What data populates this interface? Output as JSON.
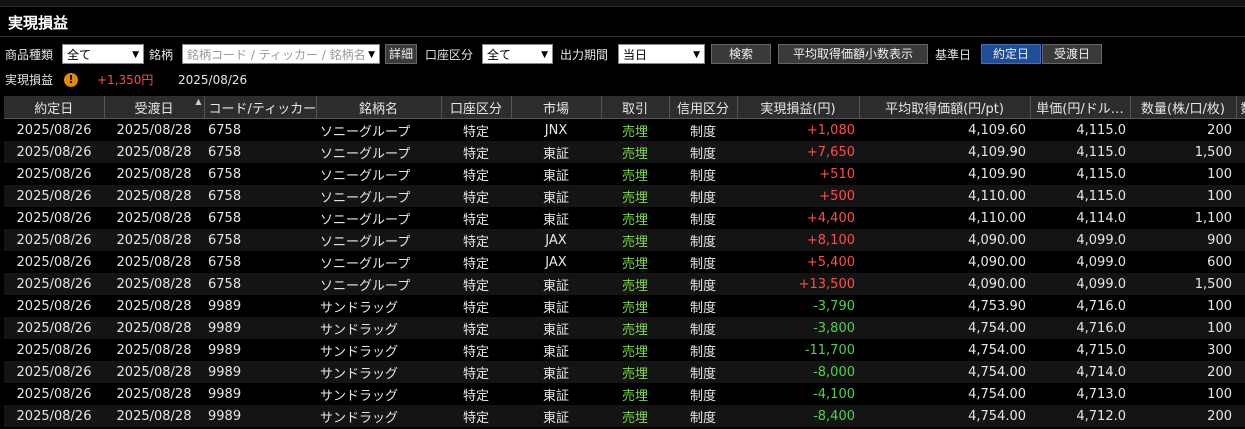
{
  "title": "実現損益",
  "toolbar": {
    "product_label": "商品種類",
    "product_value": "全て",
    "symbol_label": "銘柄",
    "symbol_placeholder": "銘柄コード / ティッカー / 銘柄名",
    "detail_button": "詳細",
    "account_label": "口座区分",
    "account_value": "全て",
    "period_label": "出力期間",
    "period_value": "当日",
    "search_button": "検索",
    "decimal_button": "平均取得価額小数表示",
    "base_date_label": "基準日",
    "contract_date_button": "約定日",
    "delivery_date_button": "受渡日"
  },
  "summary": {
    "label": "実現損益",
    "warn_glyph": "!",
    "value": "+1,350円",
    "date": "2025/08/26"
  },
  "table": {
    "headers": [
      "約定日",
      "受渡日",
      "コード/ティッカー",
      "銘柄名",
      "口座区分",
      "市場",
      "取引",
      "信用区分",
      "実現損益(円)",
      "平均取得価額(円/pt)",
      "単価(円/ドル…",
      "数量(株/口/枚)",
      "数"
    ],
    "rows": [
      [
        "2025/08/26",
        "2025/08/28",
        "6758",
        "ソニーグループ",
        "特定",
        "JNX",
        "売埋",
        "制度",
        "+1,080",
        "4,109.60",
        "4,115.0",
        "200"
      ],
      [
        "2025/08/26",
        "2025/08/28",
        "6758",
        "ソニーグループ",
        "特定",
        "東証",
        "売埋",
        "制度",
        "+7,650",
        "4,109.90",
        "4,115.0",
        "1,500"
      ],
      [
        "2025/08/26",
        "2025/08/28",
        "6758",
        "ソニーグループ",
        "特定",
        "東証",
        "売埋",
        "制度",
        "+510",
        "4,109.90",
        "4,115.0",
        "100"
      ],
      [
        "2025/08/26",
        "2025/08/28",
        "6758",
        "ソニーグループ",
        "特定",
        "東証",
        "売埋",
        "制度",
        "+500",
        "4,110.00",
        "4,115.0",
        "100"
      ],
      [
        "2025/08/26",
        "2025/08/28",
        "6758",
        "ソニーグループ",
        "特定",
        "東証",
        "売埋",
        "制度",
        "+4,400",
        "4,110.00",
        "4,114.0",
        "1,100"
      ],
      [
        "2025/08/26",
        "2025/08/28",
        "6758",
        "ソニーグループ",
        "特定",
        "JAX",
        "売埋",
        "制度",
        "+8,100",
        "4,090.00",
        "4,099.0",
        "900"
      ],
      [
        "2025/08/26",
        "2025/08/28",
        "6758",
        "ソニーグループ",
        "特定",
        "JAX",
        "売埋",
        "制度",
        "+5,400",
        "4,090.00",
        "4,099.0",
        "600"
      ],
      [
        "2025/08/26",
        "2025/08/28",
        "6758",
        "ソニーグループ",
        "特定",
        "東証",
        "売埋",
        "制度",
        "+13,500",
        "4,090.00",
        "4,099.0",
        "1,500"
      ],
      [
        "2025/08/26",
        "2025/08/28",
        "9989",
        "サンドラッグ",
        "特定",
        "東証",
        "売埋",
        "制度",
        "-3,790",
        "4,753.90",
        "4,716.0",
        "100"
      ],
      [
        "2025/08/26",
        "2025/08/28",
        "9989",
        "サンドラッグ",
        "特定",
        "東証",
        "売埋",
        "制度",
        "-3,800",
        "4,754.00",
        "4,716.0",
        "100"
      ],
      [
        "2025/08/26",
        "2025/08/28",
        "9989",
        "サンドラッグ",
        "特定",
        "東証",
        "売埋",
        "制度",
        "-11,700",
        "4,754.00",
        "4,715.0",
        "300"
      ],
      [
        "2025/08/26",
        "2025/08/28",
        "9989",
        "サンドラッグ",
        "特定",
        "東証",
        "売埋",
        "制度",
        "-8,000",
        "4,754.00",
        "4,714.0",
        "200"
      ],
      [
        "2025/08/26",
        "2025/08/28",
        "9989",
        "サンドラッグ",
        "特定",
        "東証",
        "売埋",
        "制度",
        "-4,100",
        "4,754.00",
        "4,713.0",
        "100"
      ],
      [
        "2025/08/26",
        "2025/08/28",
        "9989",
        "サンドラッグ",
        "特定",
        "東証",
        "売埋",
        "制度",
        "-8,400",
        "4,754.00",
        "4,712.0",
        "200"
      ]
    ]
  },
  "colors": {
    "positive": "#ff4d4d",
    "negative": "#4cd44c",
    "sell": "#7fd94a",
    "active_button": "#1f4e99"
  }
}
